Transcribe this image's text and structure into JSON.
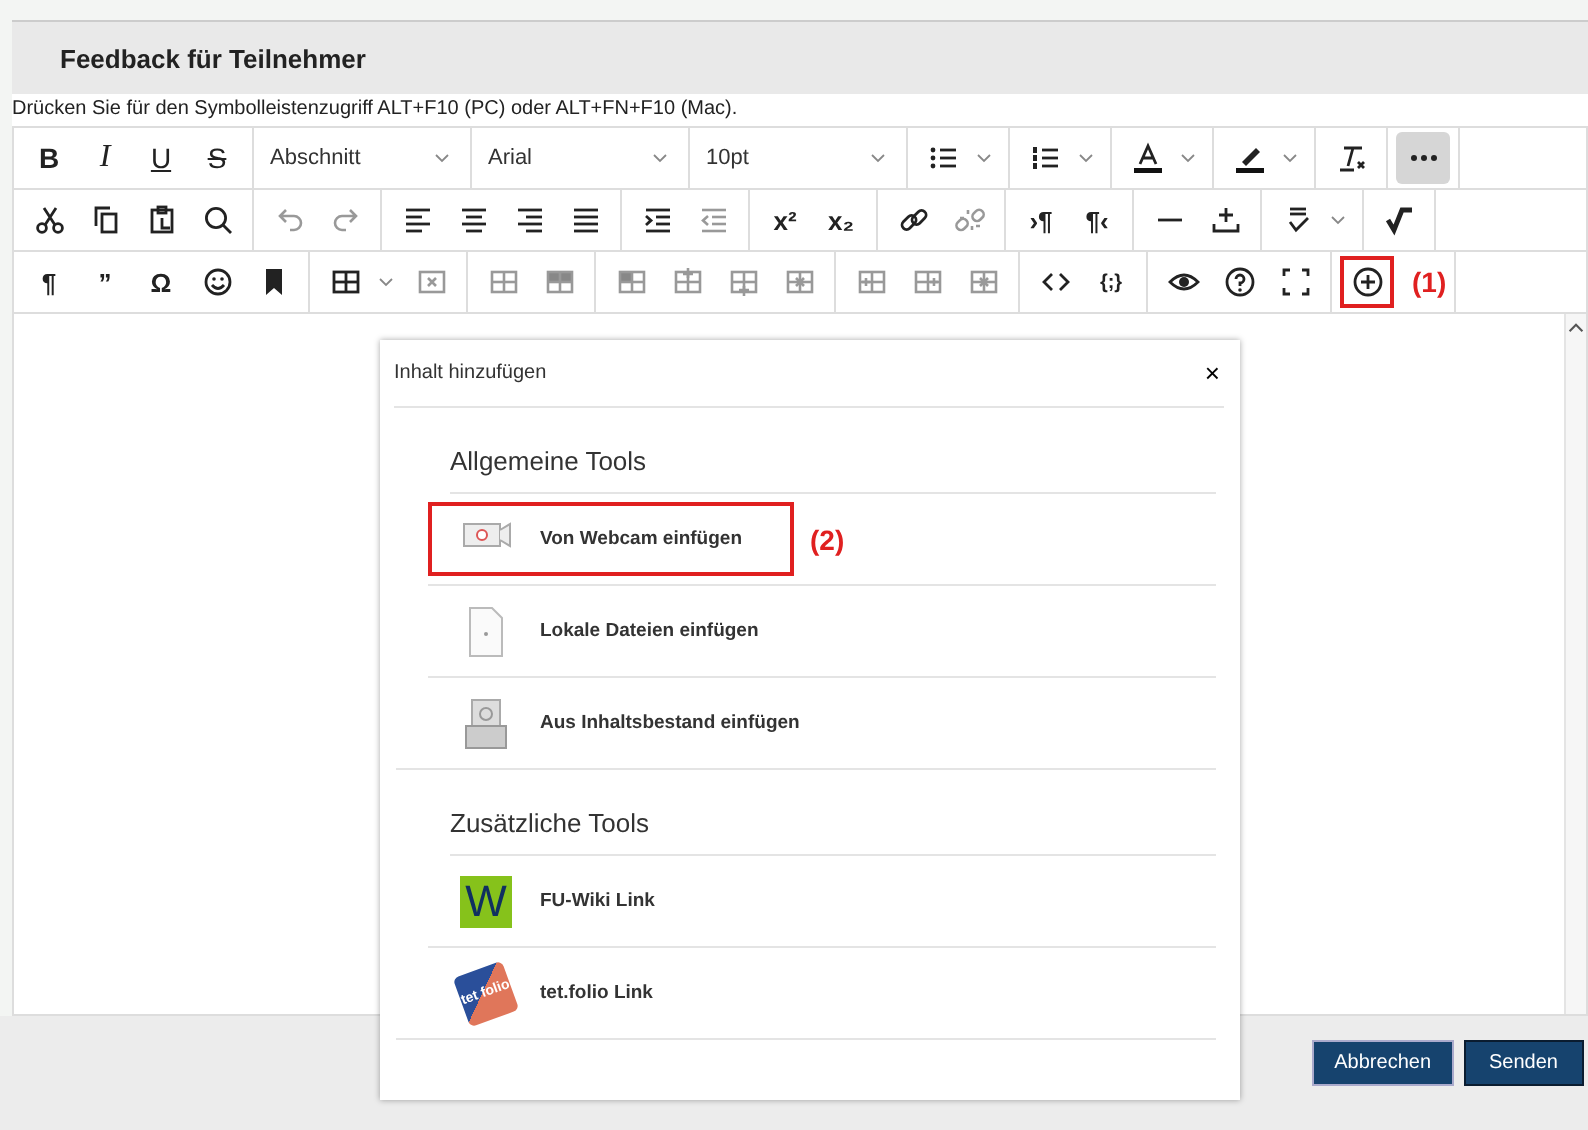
{
  "header": {
    "title": "Feedback für Teilnehmer"
  },
  "hint": "Drücken Sie für den Symbolleistenzugriff ALT+F10 (PC) oder ALT+FN+F10 (Mac).",
  "toolbar": {
    "rows": [
      [
        [
          {
            "kind": "bold",
            "text": "B"
          },
          {
            "kind": "italic",
            "text": "I"
          },
          {
            "kind": "underline",
            "text": "U"
          },
          {
            "kind": "strike",
            "text": "S"
          }
        ],
        [
          {
            "kind": "select",
            "value": "Abschnitt"
          }
        ],
        [
          {
            "kind": "select",
            "value": "Arial"
          }
        ],
        [
          {
            "kind": "select",
            "value": "10pt"
          }
        ],
        [
          {
            "kind": "bullets"
          },
          {
            "kind": "caret"
          }
        ],
        [
          {
            "kind": "numbers"
          },
          {
            "kind": "caret"
          }
        ],
        [
          {
            "kind": "fontcolor"
          },
          {
            "kind": "caret"
          }
        ],
        [
          {
            "kind": "highlight"
          },
          {
            "kind": "caret"
          }
        ],
        [
          {
            "kind": "clearformat"
          }
        ],
        [
          {
            "kind": "more"
          }
        ]
      ],
      [
        [
          {
            "kind": "cut"
          },
          {
            "kind": "copy"
          },
          {
            "kind": "paste"
          },
          {
            "kind": "search"
          }
        ],
        [
          {
            "kind": "undo"
          },
          {
            "kind": "redo"
          }
        ],
        [
          {
            "kind": "alignleft"
          },
          {
            "kind": "aligncenter"
          },
          {
            "kind": "alignright"
          },
          {
            "kind": "justify"
          }
        ],
        [
          {
            "kind": "indent"
          },
          {
            "kind": "outdent"
          }
        ],
        [
          {
            "kind": "sup",
            "text": "x²"
          },
          {
            "kind": "sub",
            "text": "x₂"
          }
        ],
        [
          {
            "kind": "link"
          },
          {
            "kind": "unlink"
          }
        ],
        [
          {
            "kind": "glyph",
            "text": "›¶"
          },
          {
            "kind": "glyph",
            "text": "¶‹"
          }
        ],
        [
          {
            "kind": "hr"
          },
          {
            "kind": "insert"
          }
        ],
        [
          {
            "kind": "spellcheck"
          },
          {
            "kind": "caret"
          }
        ],
        [
          {
            "kind": "math"
          }
        ]
      ],
      [
        [
          {
            "kind": "glyph",
            "text": "¶"
          },
          {
            "kind": "glyph",
            "text": "”"
          },
          {
            "kind": "glyph",
            "text": "Ω"
          },
          {
            "kind": "emoji"
          },
          {
            "kind": "bookmark"
          }
        ],
        [
          {
            "kind": "table"
          },
          {
            "kind": "caret"
          },
          {
            "kind": "celldelete"
          }
        ],
        [
          {
            "kind": "tablerow"
          },
          {
            "kind": "tablehead"
          }
        ],
        [
          {
            "kind": "tablecell"
          },
          {
            "kind": "rowabove"
          },
          {
            "kind": "rowbelow"
          },
          {
            "kind": "rowdelete"
          }
        ],
        [
          {
            "kind": "colbefore"
          },
          {
            "kind": "colafter"
          },
          {
            "kind": "coldelete"
          }
        ],
        [
          {
            "kind": "code"
          },
          {
            "kind": "thin",
            "text": "{;}"
          }
        ],
        [
          {
            "kind": "preview"
          },
          {
            "kind": "help"
          },
          {
            "kind": "fullscreen"
          }
        ],
        [
          {
            "kind": "add",
            "annotation": "(1)"
          }
        ]
      ]
    ]
  },
  "dialog": {
    "title": "Inhalt hinzufügen",
    "close": "×",
    "sections": [
      {
        "title": "Allgemeine Tools",
        "items": [
          {
            "kind": "webcam",
            "label": "Von Webcam einfügen",
            "annotation": "(2)"
          },
          {
            "kind": "file",
            "label": "Lokale Dateien einfügen"
          },
          {
            "kind": "repository",
            "label": "Aus Inhaltsbestand einfügen"
          }
        ]
      },
      {
        "title": "Zusätzliche Tools",
        "items": [
          {
            "kind": "wiki",
            "label": "FU-Wiki Link",
            "logo_text": "W"
          },
          {
            "kind": "tetfolio",
            "label": "tet.folio Link",
            "logo_text": "tet folio"
          }
        ]
      }
    ]
  },
  "buttons": [
    {
      "label": "Abbrechen",
      "kind": "secondary"
    },
    {
      "label": "Senden",
      "kind": "primary"
    }
  ]
}
